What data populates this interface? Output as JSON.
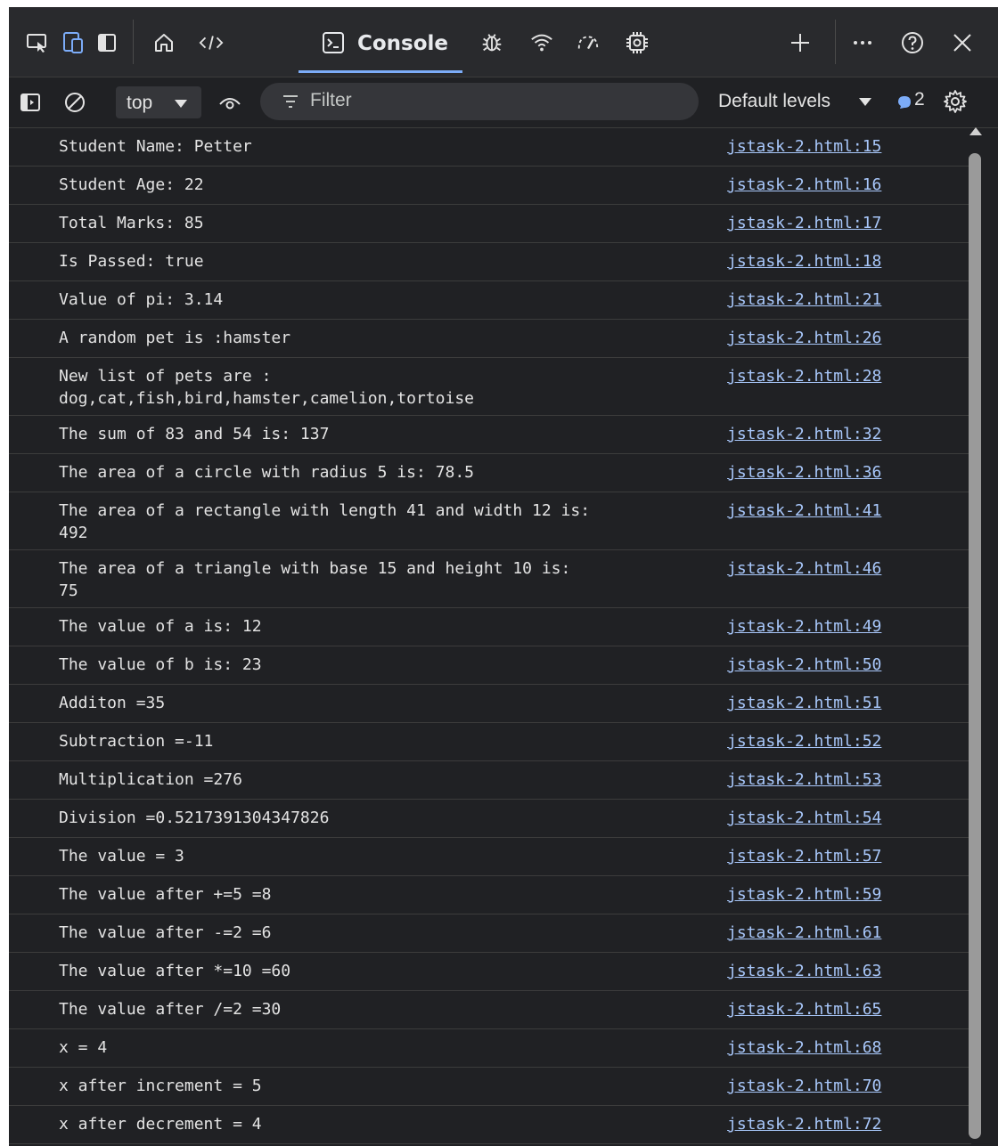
{
  "tabs": {
    "console_label": "Console"
  },
  "toolbar": {
    "context": "top",
    "filter_placeholder": "Filter",
    "levels": "Default levels",
    "issues_count": "2"
  },
  "logs": [
    {
      "msg": "Student Name: Petter",
      "src": "jstask-2.html:15"
    },
    {
      "msg": "Student Age: 22",
      "src": "jstask-2.html:16"
    },
    {
      "msg": "Total Marks: 85",
      "src": "jstask-2.html:17"
    },
    {
      "msg": "Is Passed: true",
      "src": "jstask-2.html:18"
    },
    {
      "msg": "Value of pi: 3.14",
      "src": "jstask-2.html:21"
    },
    {
      "msg": "A random pet is :hamster",
      "src": "jstask-2.html:26"
    },
    {
      "msg": "New list of pets are :\ndog,cat,fish,bird,hamster,camelion,tortoise",
      "src": "jstask-2.html:28"
    },
    {
      "msg": "The sum of 83 and 54 is: 137",
      "src": "jstask-2.html:32"
    },
    {
      "msg": "The area of a circle with radius 5 is: 78.5",
      "src": "jstask-2.html:36"
    },
    {
      "msg": "The area of a rectangle with length 41 and width 12 is:\n492",
      "src": "jstask-2.html:41"
    },
    {
      "msg": "The area of a triangle with base 15 and height 10 is:\n75",
      "src": "jstask-2.html:46"
    },
    {
      "msg": "The value of a is: 12",
      "src": "jstask-2.html:49"
    },
    {
      "msg": "The value of b is: 23",
      "src": "jstask-2.html:50"
    },
    {
      "msg": "Additon =35",
      "src": "jstask-2.html:51"
    },
    {
      "msg": "Subtraction =-11",
      "src": "jstask-2.html:52"
    },
    {
      "msg": "Multiplication =276",
      "src": "jstask-2.html:53"
    },
    {
      "msg": "Division =0.5217391304347826",
      "src": "jstask-2.html:54"
    },
    {
      "msg": "The value = 3",
      "src": "jstask-2.html:57"
    },
    {
      "msg": "The value after +=5 =8",
      "src": "jstask-2.html:59"
    },
    {
      "msg": "The value after -=2 =6",
      "src": "jstask-2.html:61"
    },
    {
      "msg": "The value after *=10 =60",
      "src": "jstask-2.html:63"
    },
    {
      "msg": "The value after /=2 =30",
      "src": "jstask-2.html:65"
    },
    {
      "msg": "x = 4",
      "src": "jstask-2.html:68"
    },
    {
      "msg": "x after increment = 5",
      "src": "jstask-2.html:70"
    },
    {
      "msg": "x after decrement = 4",
      "src": "jstask-2.html:72"
    }
  ]
}
